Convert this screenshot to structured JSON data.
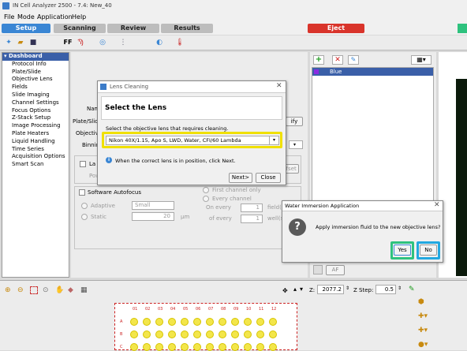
{
  "window": {
    "title": "IN Cell Analyzer 2500 - 7.4: New_40"
  },
  "menu": [
    "File",
    "Mode",
    "Application",
    "Help"
  ],
  "tabs": {
    "setup": "Setup",
    "scanning": "Scanning",
    "review": "Review",
    "results": "Results",
    "eject": "Eject"
  },
  "sidebar": {
    "header": "Dashboard",
    "items": [
      "Protocol Info",
      "Plate/Slide",
      "Objective Lens",
      "Fields",
      "Slide Imaging",
      "Channel Settings",
      "Focus Options",
      "Z-Stack Setup",
      "Image Processing",
      "Plate Heaters",
      "Liquid Handling",
      "Time Series",
      "Acquisition Options",
      "Smart Scan"
    ]
  },
  "main": {
    "name_label": "Nam",
    "plateslide_label": "Plate/Slid",
    "objective_label": "Objectiv",
    "binning_label": "Binning",
    "verify_fragment": "ify",
    "laser_autofocus_fragment": "La",
    "power_fragment": "Powe",
    "offset_fragment": "ffset",
    "software_autofocus": "Software Autofocus",
    "adaptive": "Adaptive",
    "static": "Static",
    "small": "Small",
    "static_value": "20",
    "um": "µm",
    "first_channel": "First channel only",
    "every_channel": "Every channel",
    "on_every": "On every",
    "of_every": "of every",
    "on_every_value": "1",
    "of_every_value": "1",
    "field_fragment": "field(s",
    "well_fragment": "well(s)"
  },
  "channels": {
    "items": [
      "Blue"
    ],
    "af_label": "AF"
  },
  "lens_dialog": {
    "title": "Lens Cleaning",
    "heading": "Select the Lens",
    "instruction": "Select the objective lens that requires cleaning.",
    "selected_lens": "Nikon 40X/1.15, Apo S, LWD, Water, CFI/60 Lambda",
    "info": "When the correct lens is in position, click Next.",
    "next": "Next>",
    "close": "Close"
  },
  "water_dialog": {
    "title": "Water Immersion Application",
    "message": "Apply immersion fluid to the new objective lens?",
    "yes": "Yes",
    "no": "No"
  },
  "plate_toolbar": {
    "z_label": "Z:",
    "z_value": "2077.2",
    "zstep_label": "Z Step:",
    "zstep_value": "0.5"
  },
  "plate": {
    "columns": [
      "01",
      "02",
      "03",
      "04",
      "05",
      "06",
      "07",
      "08",
      "09",
      "10",
      "11",
      "12"
    ],
    "rows": [
      "A",
      "B",
      "C"
    ]
  },
  "colors": {
    "setup_tab": "#3a86d4",
    "eject_tab": "#d9342b",
    "highlight_yellow": "#f0e000",
    "highlight_green": "#2ec27e",
    "highlight_cyan": "#22a8e0",
    "well_yellow": "#f3e64a",
    "plate_red": "#cc2222"
  }
}
